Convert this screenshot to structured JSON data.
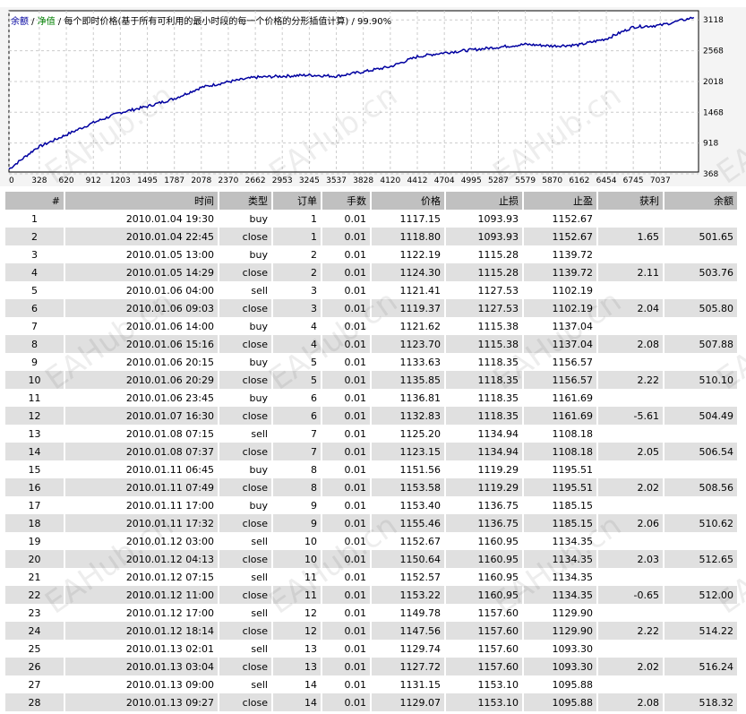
{
  "chart": {
    "legend": {
      "balance": "余额",
      "equity": "净值",
      "model": "每个即时价格(基于所有可利用的最小时段的每一个价格的分形插值计算)",
      "quality": "99.90%"
    },
    "chart_data": {
      "type": "line",
      "series": [
        {
          "name": "余额",
          "color": "#0000a0",
          "x": [
            0,
            300,
            600,
            912,
            1200,
            1495,
            1787,
            2078,
            2370,
            2662,
            2953,
            3245,
            3537,
            3828,
            4120,
            4412,
            4704,
            4995,
            5287,
            5579,
            5870,
            6162,
            6454,
            6745,
            7037,
            7400
          ],
          "y": [
            420,
            800,
            1020,
            1250,
            1430,
            1540,
            1680,
            1880,
            1980,
            2060,
            2080,
            2100,
            2080,
            2160,
            2250,
            2430,
            2500,
            2550,
            2600,
            2650,
            2620,
            2640,
            2750,
            2960,
            2990,
            3130
          ]
        }
      ],
      "xticks": [
        0,
        328,
        620,
        912,
        1203,
        1495,
        1787,
        2078,
        2370,
        2662,
        2953,
        3245,
        3537,
        3828,
        4120,
        4412,
        4704,
        4995,
        5287,
        5579,
        5870,
        6162,
        6454,
        6745,
        7037
      ],
      "yticks": [
        3118,
        2568,
        2018,
        1468,
        918,
        368
      ],
      "xlim": [
        0,
        7450
      ],
      "ylim": [
        368,
        3250
      ],
      "grid": true
    }
  },
  "table": {
    "headers": [
      "#",
      "时间",
      "类型",
      "订单",
      "手数",
      "价格",
      "止损",
      "止盈",
      "获利",
      "余额"
    ],
    "rows": [
      [
        "1",
        "2010.01.04 19:30",
        "buy",
        "1",
        "0.01",
        "1117.15",
        "1093.93",
        "1152.67",
        "",
        ""
      ],
      [
        "2",
        "2010.01.04 22:45",
        "close",
        "1",
        "0.01",
        "1118.80",
        "1093.93",
        "1152.67",
        "1.65",
        "501.65"
      ],
      [
        "3",
        "2010.01.05 13:00",
        "buy",
        "2",
        "0.01",
        "1122.19",
        "1115.28",
        "1139.72",
        "",
        ""
      ],
      [
        "4",
        "2010.01.05 14:29",
        "close",
        "2",
        "0.01",
        "1124.30",
        "1115.28",
        "1139.72",
        "2.11",
        "503.76"
      ],
      [
        "5",
        "2010.01.06 04:00",
        "sell",
        "3",
        "0.01",
        "1121.41",
        "1127.53",
        "1102.19",
        "",
        ""
      ],
      [
        "6",
        "2010.01.06 09:03",
        "close",
        "3",
        "0.01",
        "1119.37",
        "1127.53",
        "1102.19",
        "2.04",
        "505.80"
      ],
      [
        "7",
        "2010.01.06 14:00",
        "buy",
        "4",
        "0.01",
        "1121.62",
        "1115.38",
        "1137.04",
        "",
        ""
      ],
      [
        "8",
        "2010.01.06 15:16",
        "close",
        "4",
        "0.01",
        "1123.70",
        "1115.38",
        "1137.04",
        "2.08",
        "507.88"
      ],
      [
        "9",
        "2010.01.06 20:15",
        "buy",
        "5",
        "0.01",
        "1133.63",
        "1118.35",
        "1156.57",
        "",
        ""
      ],
      [
        "10",
        "2010.01.06 20:29",
        "close",
        "5",
        "0.01",
        "1135.85",
        "1118.35",
        "1156.57",
        "2.22",
        "510.10"
      ],
      [
        "11",
        "2010.01.06 23:45",
        "buy",
        "6",
        "0.01",
        "1136.81",
        "1118.35",
        "1161.69",
        "",
        ""
      ],
      [
        "12",
        "2010.01.07 16:30",
        "close",
        "6",
        "0.01",
        "1132.83",
        "1118.35",
        "1161.69",
        "-5.61",
        "504.49"
      ],
      [
        "13",
        "2010.01.08 07:15",
        "sell",
        "7",
        "0.01",
        "1125.20",
        "1134.94",
        "1108.18",
        "",
        ""
      ],
      [
        "14",
        "2010.01.08 07:37",
        "close",
        "7",
        "0.01",
        "1123.15",
        "1134.94",
        "1108.18",
        "2.05",
        "506.54"
      ],
      [
        "15",
        "2010.01.11 06:45",
        "buy",
        "8",
        "0.01",
        "1151.56",
        "1119.29",
        "1195.51",
        "",
        ""
      ],
      [
        "16",
        "2010.01.11 07:49",
        "close",
        "8",
        "0.01",
        "1153.58",
        "1119.29",
        "1195.51",
        "2.02",
        "508.56"
      ],
      [
        "17",
        "2010.01.11 17:00",
        "buy",
        "9",
        "0.01",
        "1153.40",
        "1136.75",
        "1185.15",
        "",
        ""
      ],
      [
        "18",
        "2010.01.11 17:32",
        "close",
        "9",
        "0.01",
        "1155.46",
        "1136.75",
        "1185.15",
        "2.06",
        "510.62"
      ],
      [
        "19",
        "2010.01.12 03:00",
        "sell",
        "10",
        "0.01",
        "1152.67",
        "1160.95",
        "1134.35",
        "",
        ""
      ],
      [
        "20",
        "2010.01.12 04:13",
        "close",
        "10",
        "0.01",
        "1150.64",
        "1160.95",
        "1134.35",
        "2.03",
        "512.65"
      ],
      [
        "21",
        "2010.01.12 07:15",
        "sell",
        "11",
        "0.01",
        "1152.57",
        "1160.95",
        "1134.35",
        "",
        ""
      ],
      [
        "22",
        "2010.01.12 11:00",
        "close",
        "11",
        "0.01",
        "1153.22",
        "1160.95",
        "1134.35",
        "-0.65",
        "512.00"
      ],
      [
        "23",
        "2010.01.12 17:00",
        "sell",
        "12",
        "0.01",
        "1149.78",
        "1157.60",
        "1129.90",
        "",
        ""
      ],
      [
        "24",
        "2010.01.12 18:14",
        "close",
        "12",
        "0.01",
        "1147.56",
        "1157.60",
        "1129.90",
        "2.22",
        "514.22"
      ],
      [
        "25",
        "2010.01.13 02:01",
        "sell",
        "13",
        "0.01",
        "1129.74",
        "1157.60",
        "1093.30",
        "",
        ""
      ],
      [
        "26",
        "2010.01.13 03:04",
        "close",
        "13",
        "0.01",
        "1127.72",
        "1157.60",
        "1093.30",
        "2.02",
        "516.24"
      ],
      [
        "27",
        "2010.01.13 09:00",
        "sell",
        "14",
        "0.01",
        "1131.15",
        "1153.10",
        "1095.88",
        "",
        ""
      ],
      [
        "28",
        "2010.01.13 09:27",
        "close",
        "14",
        "0.01",
        "1129.07",
        "1153.10",
        "1095.88",
        "2.08",
        "518.32"
      ]
    ]
  },
  "watermark": "EAHub.cn"
}
